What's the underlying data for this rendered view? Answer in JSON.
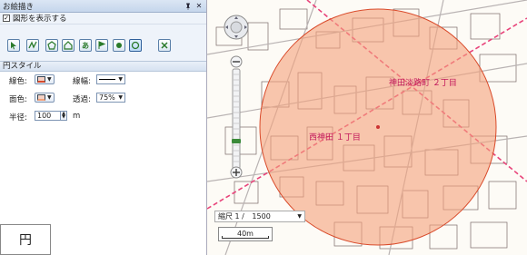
{
  "panel": {
    "title": "お絵描き",
    "pin_icon": "pin-icon",
    "close_icon": "close-icon",
    "show_shapes_label": "図形を表示する",
    "show_shapes_checked": true
  },
  "toolbar": {
    "tools": [
      "select-arrow-icon",
      "polyline-icon",
      "polygon-icon",
      "house-icon",
      "text-icon",
      "flag-icon",
      "point-icon",
      "circle-icon",
      "delete-icon"
    ]
  },
  "circle_style": {
    "title": "円スタイル",
    "line_color_label": "線色:",
    "line_width_label": "線幅:",
    "fill_color_label": "面色:",
    "transparency_label": "透過:",
    "transparency_value": "75%",
    "radius_label": "半径:",
    "radius_value": "100",
    "radius_unit": "m",
    "line_color": "#d94b2b",
    "fill_color": "#f3a07a"
  },
  "shape_label": "円",
  "map": {
    "scale_label": "縮尺 1 /",
    "scale_value": "1500",
    "scalebar_text": "40m",
    "place_labels": [
      "神田淡路町 ２丁目",
      "西神田 １丁目"
    ],
    "circle_fill": "#f5a27c",
    "road_color": "#e8437a"
  }
}
